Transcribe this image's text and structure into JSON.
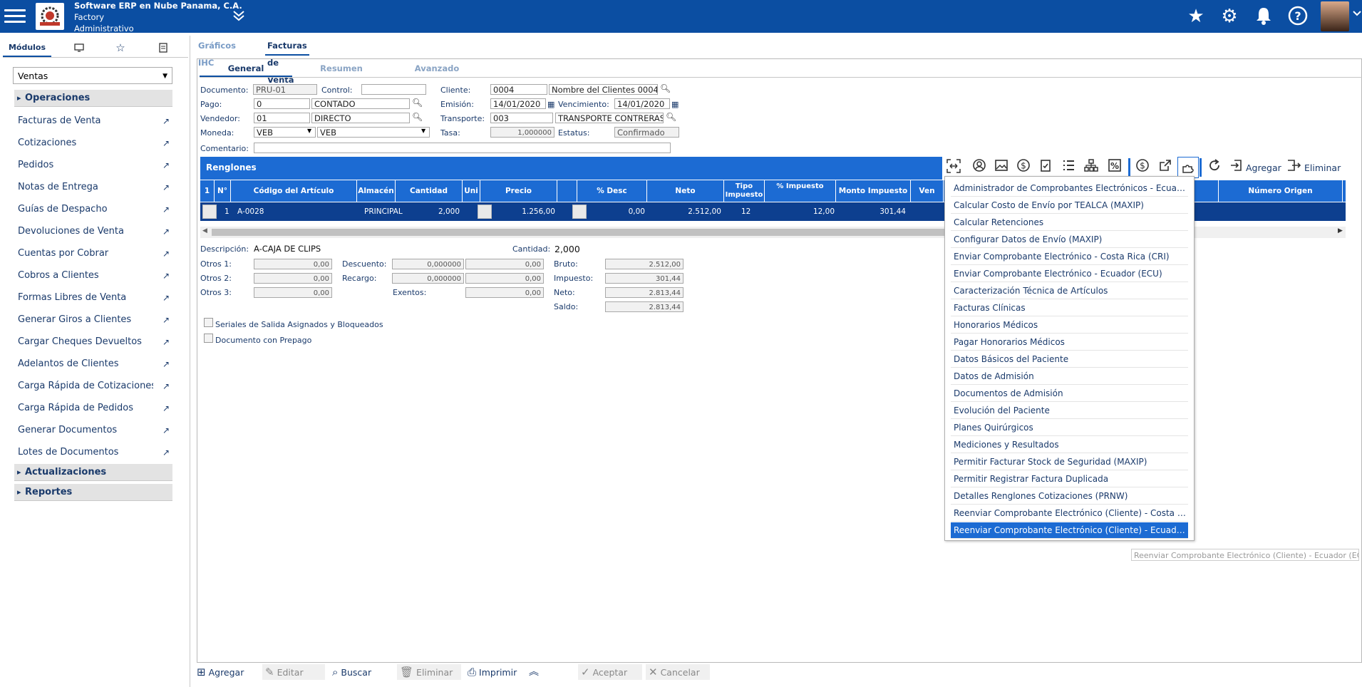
{
  "company": {
    "line1": "Software ERP en Nube Panama, C.A.",
    "line2": "Factory",
    "line3": "Administrativo"
  },
  "left": {
    "tab_modules": "Módulos",
    "module_select": "Ventas",
    "sections": {
      "operaciones": "Operaciones",
      "actualizaciones": "Actualizaciones",
      "reportes": "Reportes"
    },
    "items": [
      "Facturas de Venta",
      "Cotizaciones",
      "Pedidos",
      "Notas de Entrega",
      "Guías de Despacho",
      "Devoluciones de Venta",
      "Cuentas por Cobrar",
      "Cobros a Clientes",
      "Formas Libres de Venta",
      "Generar Giros a Clientes",
      "Cargar Cheques Devueltos",
      "Adelantos de Clientes",
      "Carga Rápida de Cotizaciones",
      "Carga Rápida de Pedidos",
      "Generar Documentos",
      "Lotes de Documentos"
    ]
  },
  "tabs": {
    "graficos": "Gráficos IHC",
    "facturas": "Facturas de Venta"
  },
  "subtabs": {
    "general": "General",
    "resumen": "Resumen",
    "avanzado": "Avanzado"
  },
  "form": {
    "documento_lbl": "Documento:",
    "documento": "PRU-01",
    "control_lbl": "Control:",
    "control": "",
    "cliente_lbl": "Cliente:",
    "cliente": "0004",
    "cliente_nombre": "Nombre del Clientes 0004",
    "pago_lbl": "Pago:",
    "pago": "0",
    "pago_desc": "CONTADO",
    "emision_lbl": "Emisión:",
    "emision": "14/01/2020",
    "venc_lbl": "Vencimiento:",
    "venc": "14/01/2020",
    "vendedor_lbl": "Vendedor:",
    "vendedor": "01",
    "vendedor_desc": "DIRECTO",
    "transporte_lbl": "Transporte:",
    "transporte": "003",
    "transporte_desc": "TRANSPORTE CONTRERAS",
    "moneda_lbl": "Moneda:",
    "moneda": "VEB",
    "moneda_desc": "VEB",
    "tasa_lbl": "Tasa:",
    "tasa": "1,000000",
    "estatus_lbl": "Estatus:",
    "estatus": "Confirmado",
    "comentario_lbl": "Comentario:",
    "comentario": ""
  },
  "grid": {
    "title": "Renglones",
    "columns": [
      "1",
      "N°",
      "Código del Artículo",
      "Almacén",
      "Cantidad",
      "Uni",
      "Precio",
      "",
      "% Desc",
      "Neto",
      "Tipo Impuesto",
      "% Impuesto",
      "Monto Impuesto",
      "Ven",
      "Número Origen"
    ],
    "row": {
      "num": "1",
      "codigo": "A-0028",
      "almacen": "PRINCIPAL",
      "cantidad": "2,000",
      "precio": "1.256,00",
      "desc": "0,00",
      "neto": "2.512,00",
      "tipo": "12",
      "pct": "12,00",
      "monto": "301,44"
    }
  },
  "toolbar": {
    "agregar": "Agregar",
    "eliminar": "Eliminar"
  },
  "menu": {
    "items": [
      "Administrador de Comprobantes Electrónicos - Ecuador (ECU)",
      "Calcular Costo de Envío por TEALCA (MAXIP)",
      "Calcular Retenciones",
      "Configurar Datos de Envío (MAXIP)",
      "Enviar Comprobante Electrónico - Costa Rica (CRI)",
      "Enviar Comprobante Electrónico - Ecuador (ECU)",
      "Caracterización Técnica de Artículos",
      "Facturas Clínicas",
      "Honorarios Médicos",
      "Pagar Honorarios Médicos",
      "Datos Básicos del Paciente",
      "Datos de Admisión",
      "Documentos de Admisión",
      "Evolución del Paciente",
      "Planes Quirúrgicos",
      "Mediciones y Resultados",
      "Permitir Facturar Stock de Seguridad (MAXIP)",
      "Permitir Registrar Factura Duplicada",
      "Detalles Renglones Cotizaciones (PRNW)",
      "Reenviar Comprobante Electrónico (Cliente) - Costa Rica",
      "Reenviar Comprobante Electrónico (Cliente) - Ecuador (ECU)"
    ],
    "selected_index": 20,
    "tooltip": "Reenviar Comprobante Electrónico (Cliente) - Ecuador (ECU)"
  },
  "detail": {
    "descripcion_lbl": "Descripción:",
    "descripcion": "A-CAJA DE CLIPS",
    "cantidad_lbl": "Cantidad:",
    "cantidad": "2,000",
    "otros1_lbl": "Otros 1:",
    "otros1": "0,00",
    "otros2_lbl": "Otros 2:",
    "otros2": "0,00",
    "otros3_lbl": "Otros 3:",
    "otros3": "0,00",
    "descuento_lbl": "Descuento:",
    "descuento_pct": "0,000000",
    "descuento": "0,00",
    "recargo_lbl": "Recargo:",
    "recargo_pct": "0,000000",
    "recargo": "0,00",
    "exentos_lbl": "Exentos:",
    "exentos": "0,00",
    "bruto_lbl": "Bruto:",
    "bruto": "2.512,00",
    "impuesto_lbl": "Impuesto:",
    "impuesto": "301,44",
    "neto_lbl": "Neto:",
    "neto": "2.813,44",
    "saldo_lbl": "Saldo:",
    "saldo": "2.813,44",
    "chk1": "Seriales de Salida Asignados y Bloqueados",
    "chk2": "Documento con Prepago"
  },
  "bottom": {
    "agregar": "Agregar",
    "editar": "Editar",
    "buscar": "Buscar",
    "eliminar": "Eliminar",
    "imprimir": "Imprimir",
    "aceptar": "Aceptar",
    "cancelar": "Cancelar"
  }
}
